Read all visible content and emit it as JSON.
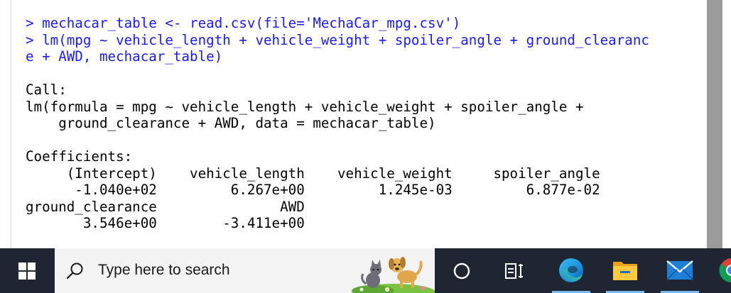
{
  "console": {
    "lines": [
      {
        "text": "> mechacar_table <- read.csv(file='MechaCar_mpg.csv')",
        "kind": "cmd"
      },
      {
        "text": "> lm(mpg ~ vehicle_length + vehicle_weight + spoiler_angle + ground_clearanc",
        "kind": "cmd"
      },
      {
        "text": "e + AWD, mechacar_table)",
        "kind": "cmd"
      },
      {
        "text": "",
        "kind": "out"
      },
      {
        "text": "Call:",
        "kind": "out"
      },
      {
        "text": "lm(formula = mpg ~ vehicle_length + vehicle_weight + spoiler_angle + ",
        "kind": "out"
      },
      {
        "text": "    ground_clearance + AWD, data = mechacar_table)",
        "kind": "out"
      },
      {
        "text": "",
        "kind": "out"
      },
      {
        "text": "Coefficients:",
        "kind": "out"
      },
      {
        "text": "     (Intercept)    vehicle_length    vehicle_weight     spoiler_angle  ",
        "kind": "out"
      },
      {
        "text": "      -1.040e+02         6.267e+00         1.245e-03         6.877e-02  ",
        "kind": "out"
      },
      {
        "text": "ground_clearance               AWD  ",
        "kind": "out"
      },
      {
        "text": "       3.546e+00        -3.411e+00  ",
        "kind": "out"
      }
    ]
  },
  "taskbar": {
    "search_placeholder": "Type here to search",
    "icons": [
      {
        "name": "task-view-icon"
      },
      {
        "name": "widgets-icon"
      },
      {
        "name": "edge-icon",
        "active": true
      },
      {
        "name": "file-explorer-icon",
        "active": true
      },
      {
        "name": "mail-icon",
        "active": true
      },
      {
        "name": "chrome-icon"
      }
    ]
  },
  "colors": {
    "command": "#1a1aff",
    "output": "#000000",
    "taskbar": "#1f2531",
    "scrollbar": "#9b9b9b"
  }
}
